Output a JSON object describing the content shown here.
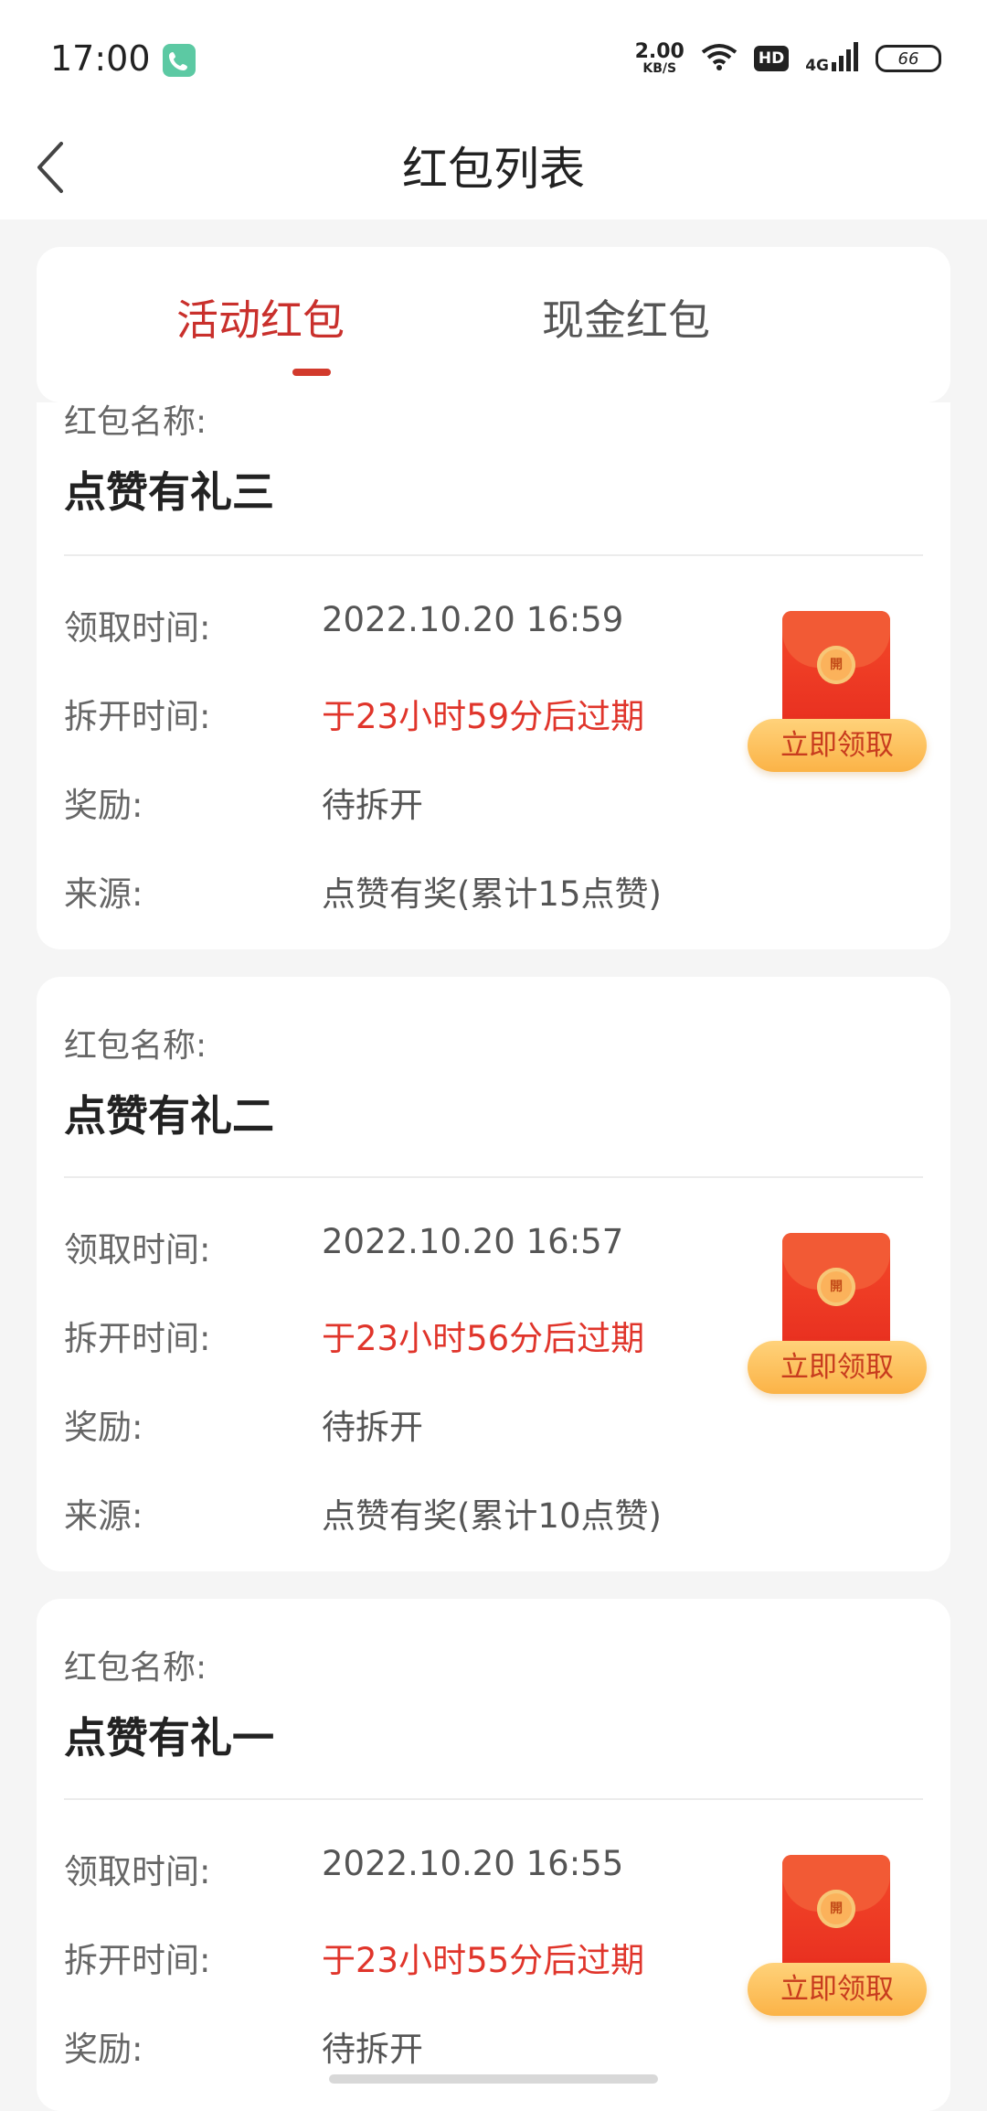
{
  "status_bar": {
    "time": "17:00",
    "speed_value": "2.00",
    "speed_unit": "KB/S",
    "hd": "HD",
    "network": "4G",
    "battery": "66"
  },
  "header": {
    "title": "红包列表"
  },
  "tabs": {
    "active": "活动红包",
    "inactive": "现金红包"
  },
  "labels": {
    "name": "红包名称:",
    "receive_time": "领取时间:",
    "open_time": "拆开时间:",
    "reward": "奖励:",
    "source": "来源:",
    "claim_button": "立即领取",
    "seal_glyph": "開"
  },
  "colors": {
    "accent_red": "#c9302c",
    "expire_red": "#e0352b",
    "button_gold": "#fbb347"
  },
  "cards": [
    {
      "name": "点赞有礼三",
      "receive_time": "2022.10.20 16:59",
      "open_time": "于23小时59分后过期",
      "reward": "待拆开",
      "source": "点赞有奖(累计15点赞)"
    },
    {
      "name": "点赞有礼二",
      "receive_time": "2022.10.20 16:57",
      "open_time": "于23小时56分后过期",
      "reward": "待拆开",
      "source": "点赞有奖(累计10点赞)"
    },
    {
      "name": "点赞有礼一",
      "receive_time": "2022.10.20 16:55",
      "open_time": "于23小时55分后过期",
      "reward": "待拆开"
    }
  ]
}
